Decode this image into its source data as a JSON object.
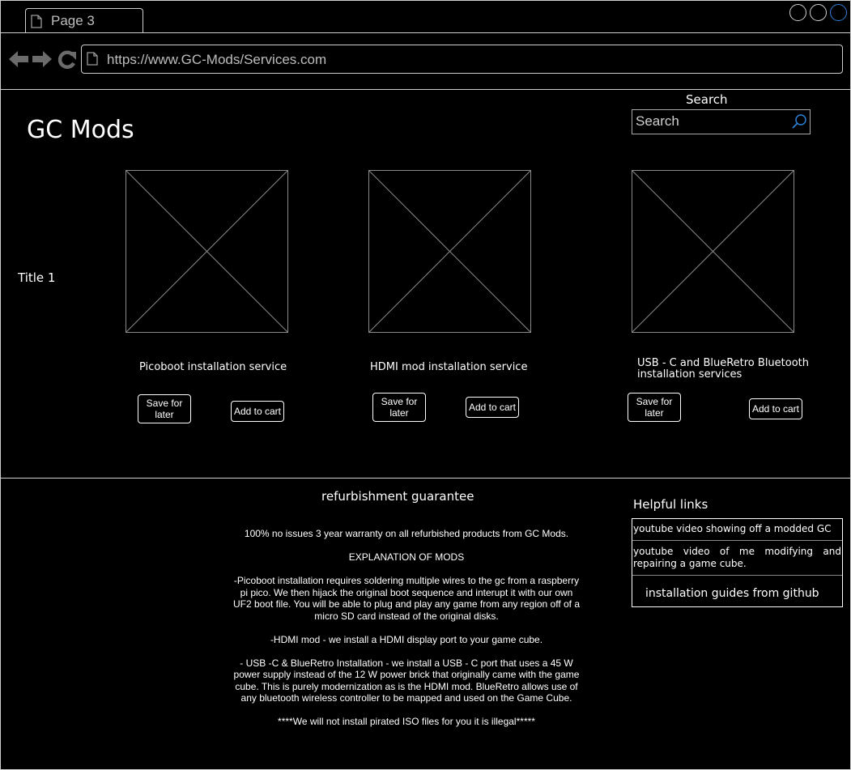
{
  "browser": {
    "tab_title": "Page 3",
    "url": "https://www.GC-Mods/Services.com"
  },
  "header": {
    "logo": "GC Mods",
    "search_label": "Search",
    "search_placeholder": "Search"
  },
  "section_title": "Title 1",
  "products": [
    {
      "name": "Picoboot installation service",
      "save_label": "Save for later",
      "cart_label": "Add to cart"
    },
    {
      "name": "HDMI mod installation service",
      "save_label": "Save for later",
      "cart_label": "Add to cart"
    },
    {
      "name": "USB - C and BlueRetro Bluetooth installation services",
      "save_label": "Save for later",
      "cart_label": "Add to cart"
    }
  ],
  "guarantee": {
    "title": "refurbishment guarantee",
    "warranty": "100% no issues 3 year warranty on all refurbished products from GC Mods.",
    "explanation_heading": "EXPLANATION OF MODS",
    "picoboot": "-Picoboot installation requires soldering multiple wires to the gc from a raspberry pi pico. We then hijack the original boot sequence and interupt it with our own UF2 boot file. You will be able to plug and play any game from any region off of a micro SD card instead of the original disks.",
    "hdmi": "-HDMI mod - we install a HDMI display port to your game cube.",
    "usbc": "- USB -C & BlueRetro Installation - we install a USB - C port that uses a 45 W power supply instead of the 12 W power brick that originally came with the game cube. This is purely modernization as is the HDMI mod. BlueRetro allows use of any bluetooth wireless controller to be mapped and used on the Game Cube.",
    "notice": "****We will not install pirated ISO files for you it is illegal*****"
  },
  "helpful_links": {
    "title": "Helpful links",
    "items": [
      "youtube video showing off a modded GC",
      "youtube video of me modifying and repairing a game cube.",
      "installation guides from github"
    ]
  }
}
